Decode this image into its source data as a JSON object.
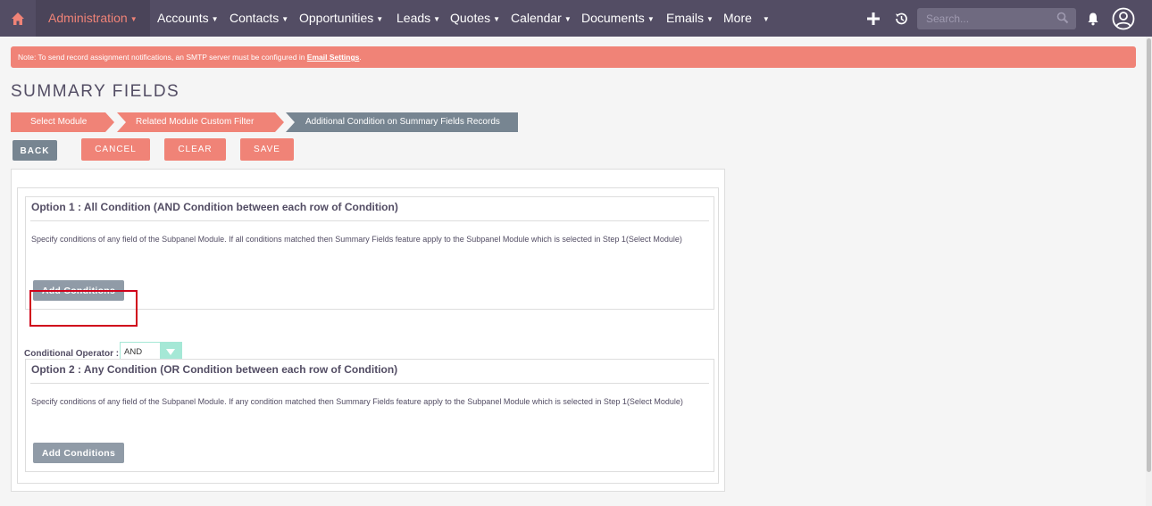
{
  "nav": {
    "items": [
      {
        "label": "Administration",
        "active": true
      },
      {
        "label": "Accounts"
      },
      {
        "label": "Contacts"
      },
      {
        "label": "Opportunities"
      },
      {
        "label": "Leads"
      },
      {
        "label": "Quotes"
      },
      {
        "label": "Calendar"
      },
      {
        "label": "Documents"
      },
      {
        "label": "Emails"
      },
      {
        "label": "More"
      }
    ],
    "search_placeholder": "Search...",
    "icons": [
      "home-icon",
      "plus-icon",
      "history-icon",
      "search-icon",
      "bell-icon",
      "user-icon"
    ]
  },
  "notice": {
    "text": "Note: To send record assignment notifications, an SMTP server must be configured in ",
    "link": "Email Settings",
    "suffix": "."
  },
  "page_title": "SUMMARY FIELDS",
  "steps": [
    {
      "label": "Select Module",
      "state": "done"
    },
    {
      "label": "Related Module Custom Filter",
      "state": "done"
    },
    {
      "label": "Additional Condition on Summary Fields Records",
      "state": "current"
    }
  ],
  "buttons": {
    "back": "BACK",
    "cancel": "CANCEL",
    "clear": "CLEAR",
    "save": "SAVE"
  },
  "option1": {
    "title": "Option 1 : All Condition (AND Condition between each row of Condition)",
    "desc": "Specify conditions of any field of the Subpanel Module. If all conditions matched then Summary Fields feature apply to the Subpanel Module which is selected in Step 1(Select Module)",
    "button": "Add Conditions"
  },
  "operator": {
    "label": "Conditional Operator :",
    "value": "AND"
  },
  "option2": {
    "title": "Option 2 : Any Condition (OR Condition between each row of Condition)",
    "desc": "Specify conditions of any field of the Subpanel Module. If any condition matched then Summary Fields feature apply to the Subpanel Module which is selected in Step 1(Select Module)",
    "button": "Add Conditions"
  },
  "colors": {
    "nav_bg": "#534d64",
    "accent": "#f08377",
    "button_grey": "#778591",
    "select_accent": "#a5e8d6",
    "highlight": "#d0021b"
  }
}
